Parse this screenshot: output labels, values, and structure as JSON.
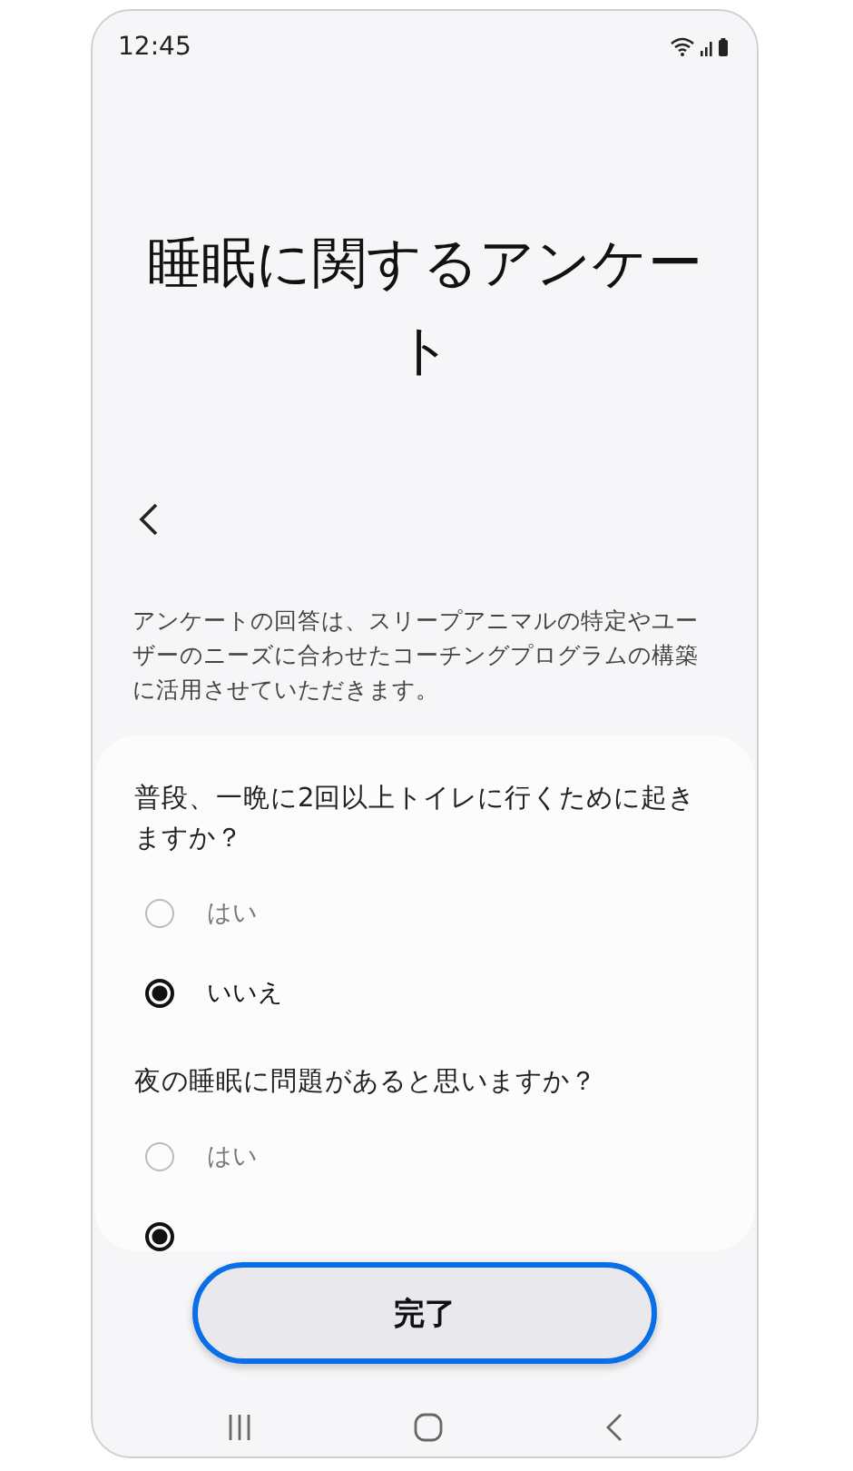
{
  "status_bar": {
    "time": "12:45"
  },
  "title": "睡眠に関するアンケート",
  "description": "アンケートの回答は、スリープアニマルの特定やユーザーのニーズに合わせたコーチングプログラムの構築に活用させていただきます。",
  "questions": [
    {
      "text": "普段、一晩に2回以上トイレに行くために起きますか？",
      "options": [
        {
          "label": "はい",
          "selected": false
        },
        {
          "label": "いいえ",
          "selected": true
        }
      ]
    },
    {
      "text": "夜の睡眠に問題があると思いますか？",
      "options": [
        {
          "label": "はい",
          "selected": false
        },
        {
          "selected": true
        }
      ]
    }
  ],
  "done_button": "完了"
}
